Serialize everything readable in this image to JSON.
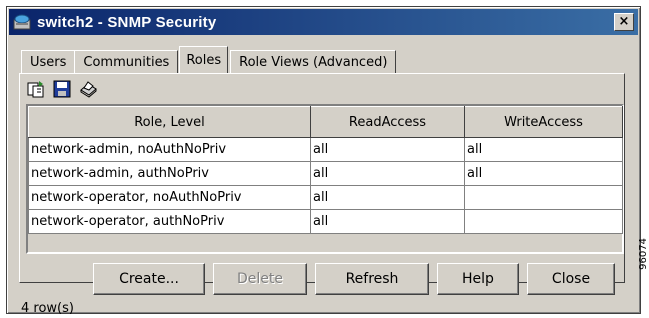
{
  "window": {
    "title": "switch2 - SNMP Security",
    "close_label": "×"
  },
  "tabs": [
    {
      "label": "Users",
      "active": false
    },
    {
      "label": "Communities",
      "active": false
    },
    {
      "label": "Roles",
      "active": true
    },
    {
      "label": "Role Views (Advanced)",
      "active": false
    }
  ],
  "toolbar": {
    "icons": [
      "copy-icon",
      "save-icon",
      "print-icon"
    ]
  },
  "table": {
    "headers": [
      "Role, Level",
      "ReadAccess",
      "WriteAccess"
    ],
    "rows": [
      [
        "network-admin, noAuthNoPriv",
        "all",
        "all"
      ],
      [
        "network-admin, authNoPriv",
        "all",
        "all"
      ],
      [
        "network-operator, noAuthNoPriv",
        "all",
        ""
      ],
      [
        "network-operator, authNoPriv",
        "all",
        ""
      ]
    ]
  },
  "buttons": {
    "create": "Create...",
    "delete": "Delete",
    "refresh": "Refresh",
    "help": "Help",
    "close": "Close"
  },
  "status": {
    "row_count": "4 row(s)"
  },
  "side_id": "96074"
}
